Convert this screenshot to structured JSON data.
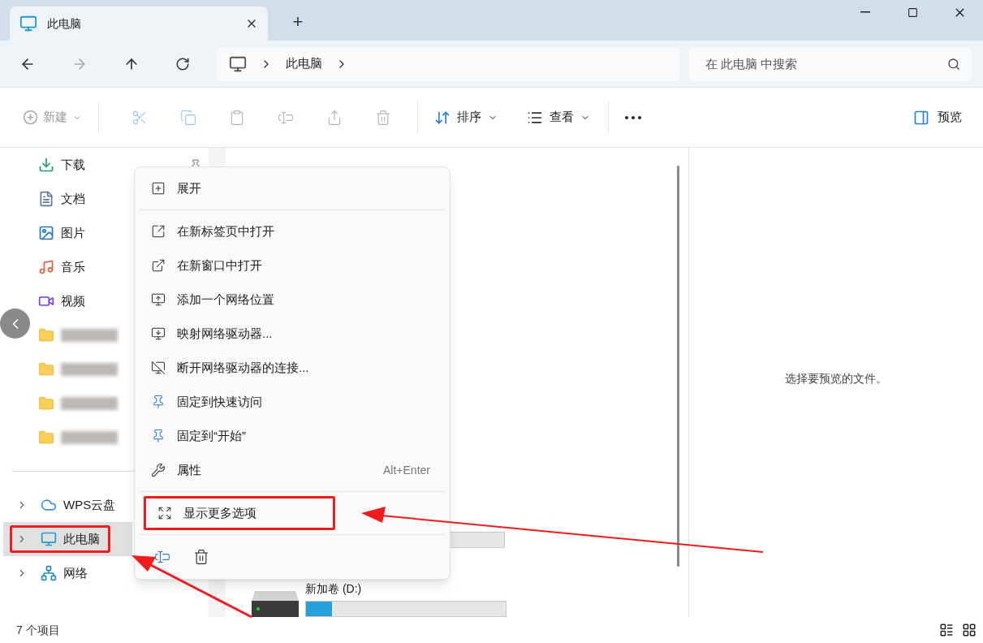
{
  "window": {
    "tab_title": "此电脑",
    "new_tab": "+"
  },
  "address": {
    "crumbs": [
      "此电脑"
    ],
    "search_placeholder": "在 此电脑 中搜索"
  },
  "toolbar": {
    "new": {
      "label": "新建",
      "disabled": true
    },
    "sort": "排序",
    "view": "查看",
    "preview": "预览"
  },
  "sidebar": {
    "quick": [
      {
        "label": "下载",
        "kind": "named"
      },
      {
        "label": "文档",
        "kind": "named"
      },
      {
        "label": "图片",
        "kind": "named"
      },
      {
        "label": "音乐",
        "kind": "named"
      },
      {
        "label": "视频",
        "kind": "named"
      },
      {
        "kind": "blurred"
      },
      {
        "kind": "blurred"
      },
      {
        "kind": "blurred"
      },
      {
        "kind": "blurred"
      }
    ],
    "places": [
      {
        "label": "WPS云盘",
        "selected": false,
        "annotated": false
      },
      {
        "label": "此电脑",
        "selected": true,
        "annotated": true
      },
      {
        "label": "网络",
        "selected": false,
        "annotated": false
      }
    ]
  },
  "content": {
    "drive": {
      "name": "新加卷 (D:)",
      "level": 0.13
    }
  },
  "preview_message": "选择要预览的文件。",
  "context_menu": {
    "expand": "展开",
    "items": [
      {
        "label": "在新标签页中打开"
      },
      {
        "label": "在新窗口中打开"
      },
      {
        "label": "添加一个网络位置"
      },
      {
        "label": "映射网络驱动器..."
      },
      {
        "label": "断开网络驱动器的连接..."
      },
      {
        "label": "固定到快速访问"
      },
      {
        "label": "固定到“开始”"
      },
      {
        "label": "属性",
        "shortcut": "Alt+Enter"
      }
    ],
    "more": {
      "label": "显示更多选项",
      "annotated": true
    }
  },
  "status_bar": {
    "count": "7 个项目"
  }
}
